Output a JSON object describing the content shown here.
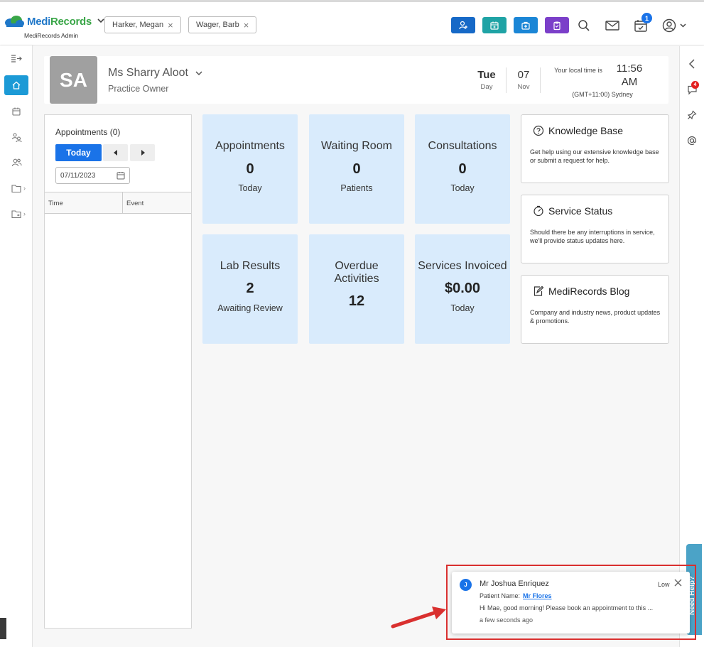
{
  "header": {
    "brand_medi": "Medi",
    "brand_records": "Records",
    "brand_sub": "MediRecords Admin",
    "patient_tabs": [
      {
        "label": "Harker, Megan"
      },
      {
        "label": "Wager, Barb"
      }
    ],
    "action_colors": [
      "#1669c7",
      "#1fa3a5",
      "#1b86d6",
      "#7b3fc9"
    ],
    "notification_count": "1"
  },
  "profile": {
    "initials": "SA",
    "name": "Ms Sharry Aloot",
    "role": "Practice Owner",
    "day_value": "Tue",
    "day_label": "Day",
    "month_value": "07",
    "month_label": "Nov",
    "local_time_label": "Your local time is",
    "local_time_value": "11:56 AM",
    "timezone": "(GMT+11:00) Sydney"
  },
  "appointments": {
    "title": "Appointments (0)",
    "today_button": "Today",
    "date_value": "07/11/2023",
    "columns": [
      "Time",
      "Event"
    ]
  },
  "tiles": [
    {
      "title": "Appointments",
      "value": "0",
      "sub": "Today"
    },
    {
      "title": "Waiting Room",
      "value": "0",
      "sub": "Patients"
    },
    {
      "title": "Consultations",
      "value": "0",
      "sub": "Today"
    },
    {
      "title": "Lab Results",
      "value": "2",
      "sub": "Awaiting Review"
    },
    {
      "title": "Overdue Activities",
      "value": "12",
      "sub": ""
    },
    {
      "title": "Services Invoiced",
      "value": "$0.00",
      "sub": "Today"
    }
  ],
  "cards": [
    {
      "title": "Knowledge Base",
      "desc": "Get help using our extensive knowledge base or submit a request for help.",
      "icon": "question-circle-icon"
    },
    {
      "title": "Service Status",
      "desc": "Should there be any interruptions in service, we'll provide status updates here.",
      "icon": "gauge-icon"
    },
    {
      "title": "MediRecords Blog",
      "desc": "Company and industry news, product updates & promotions.",
      "icon": "edit-note-icon"
    }
  ],
  "rightbar": {
    "chat_badge": "4",
    "need_help": "Need Help?"
  },
  "toast": {
    "avatar": "J",
    "sender": "Mr Joshua Enriquez",
    "priority": "Low",
    "patient_label": "Patient Name:",
    "patient_name": "Mr Flores",
    "message": "Hi Mae, good morning! Please book an appointment to this ...",
    "time": "a few seconds ago"
  },
  "colors": {
    "accent": "#1a73e8",
    "tile_bg": "#d9ebfc",
    "sidebar_active": "#1c9ad6",
    "highlight": "#d9302f"
  }
}
